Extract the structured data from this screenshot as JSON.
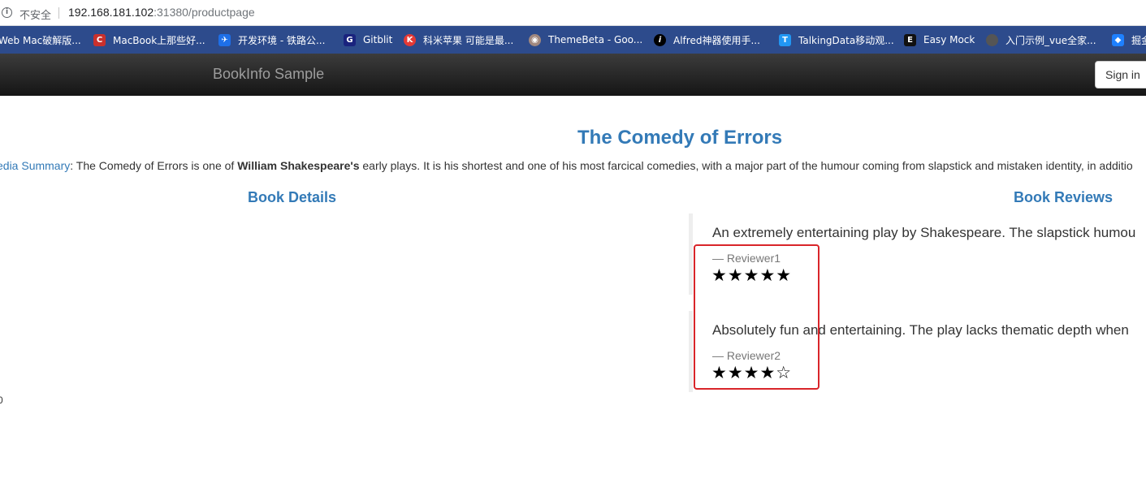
{
  "browser": {
    "security_label": "不安全",
    "url_host": "192.168.181.102",
    "url_rest": ":31380/productpage",
    "bookmarks": [
      {
        "label": "Web Mac破解版...",
        "icon": "bookmark-icon",
        "color": "#2d4b8c"
      },
      {
        "label": "MacBook上那些好...",
        "icon": "c-logo-icon",
        "color": "#c9302c"
      },
      {
        "label": "开发环境 - 铁路公...",
        "icon": "bird-icon",
        "color": "#1e6fe8"
      },
      {
        "label": "Gitblit",
        "icon": "gitblit-icon",
        "color": "#1a237e"
      },
      {
        "label": "科米苹果 可能是最...",
        "icon": "k-logo-icon",
        "color": "#e53935"
      },
      {
        "label": "ThemeBeta - Goo...",
        "icon": "palette-icon",
        "color": "#8d6e63"
      },
      {
        "label": "Alfred神器使用手...",
        "icon": "info-i-icon",
        "color": "#000000"
      },
      {
        "label": "TalkingData移动观...",
        "icon": "t-logo-icon",
        "color": "#2196f3"
      },
      {
        "label": "Easy Mock",
        "icon": "easymock-icon",
        "color": "#111111"
      },
      {
        "label": "入门示例_vue全家...",
        "icon": "globe-icon",
        "color": "#555555"
      },
      {
        "label": "掘金",
        "icon": "juejin-icon",
        "color": "#1e80ff"
      }
    ]
  },
  "app": {
    "brand": "BookInfo Sample",
    "signin_label": "Sign in"
  },
  "product": {
    "title": "The Comedy of Errors",
    "summary_link": "edia Summary",
    "summary_colon": ": ",
    "summary_text1": "The Comedy of Errors is one of ",
    "summary_bold": "William Shakespeare's",
    "summary_text2": " early plays. It is his shortest and one of his most farcical comedies, with a major part of the humour coming from slapstick and mistaken identity, in additio",
    "details_heading": "Book Details",
    "reviews_heading": "Book Reviews",
    "stray_text": "0"
  },
  "reviews": [
    {
      "text": "An extremely entertaining play by Shakespeare. The slapstick humou",
      "reviewer": "— Reviewer1",
      "rating": 5,
      "stars": "★★★★★"
    },
    {
      "text": "Absolutely fun and entertaining. The play lacks thematic depth when",
      "reviewer": "— Reviewer2",
      "rating": 4,
      "stars": "★★★★☆"
    }
  ],
  "colors": {
    "accent": "#337ab7",
    "highlight_box": "#d9252a",
    "navbar": "#222222",
    "bookmarks_bar": "#2d4b8c"
  }
}
